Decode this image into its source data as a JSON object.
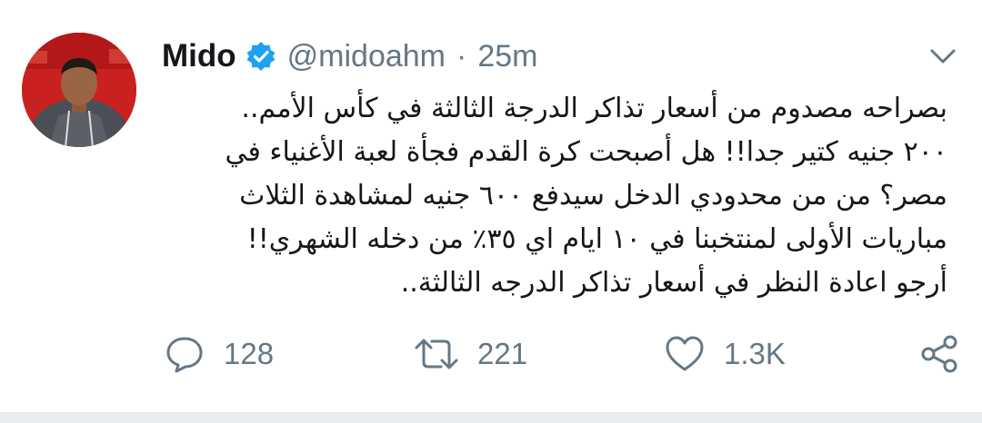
{
  "user": {
    "display_name": "Mido",
    "handle": "@midoahm",
    "separator": "·",
    "time": "25m",
    "verified": true
  },
  "tweet": {
    "lines": [
      "بصراحه مصدوم من أسعار تذاكر الدرجة الثالثة في كأس الأمم..",
      "٢٠٠ جنيه كتير جدا!! هل أصبحت كرة القدم فجأة لعبة الأغنياء في",
      "مصر؟ من من محدودي الدخل سيدفع ٦٠٠ جنيه لمشاهدة الثلاث",
      "مباريات الأولى لمنتخبنا في ١٠ ايام اي ٣٥٪ من دخله الشهري!!",
      "أرجو اعادة النظر في أسعار تذاكر الدرجه الثالثة.."
    ]
  },
  "actions": {
    "reply_icon": "reply-icon",
    "reply_count": "128",
    "retweet_icon": "retweet-icon",
    "retweet_count": "221",
    "like_icon": "heart-icon",
    "like_count": "1.3K",
    "share_icon": "share-icon"
  },
  "colors": {
    "text": "#14171a",
    "secondary": "#657786",
    "verified_blue": "#1da1f2",
    "divider": "#e6ecf0"
  }
}
